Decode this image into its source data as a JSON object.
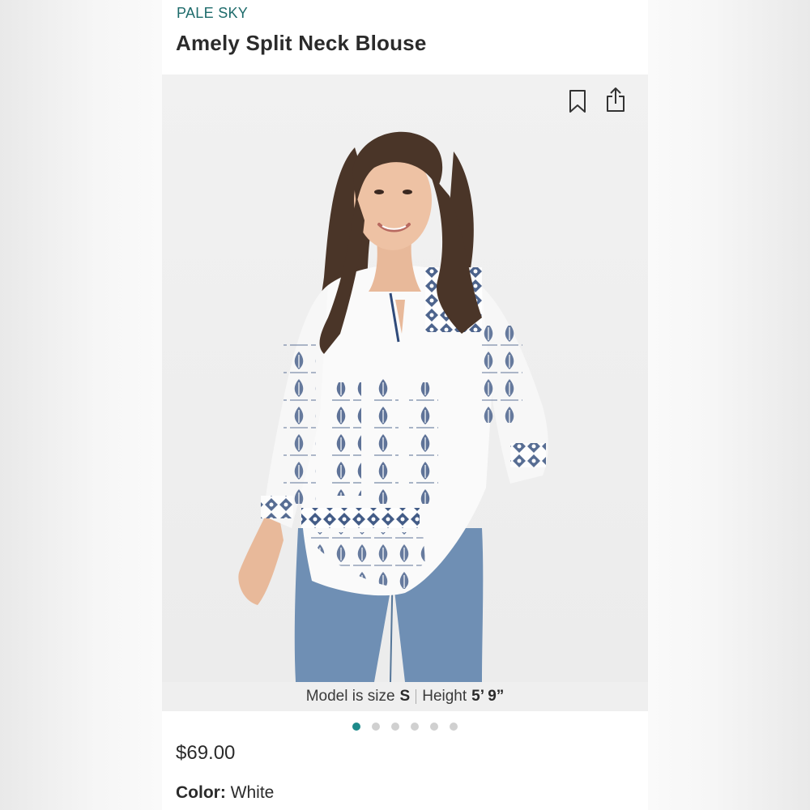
{
  "product": {
    "brand": "PALE SKY",
    "title": "Amely Split Neck Blouse",
    "price": "$69.00"
  },
  "gallery": {
    "image_count": 6,
    "active_index": 0,
    "caption": {
      "model_prefix": "Model is size",
      "model_size": "S",
      "height_prefix": "Height",
      "height_value": "5’ 9”"
    },
    "actions": {
      "save_icon": "bookmark-icon",
      "share_icon": "share-icon"
    }
  },
  "options": {
    "color_label": "Color:",
    "color_value": "White"
  },
  "colors": {
    "brand_teal": "#1d6b6b",
    "active_dot": "#1d8a8a",
    "inactive_dot": "#d0d0d0",
    "print_navy": "#2f4a7a"
  }
}
